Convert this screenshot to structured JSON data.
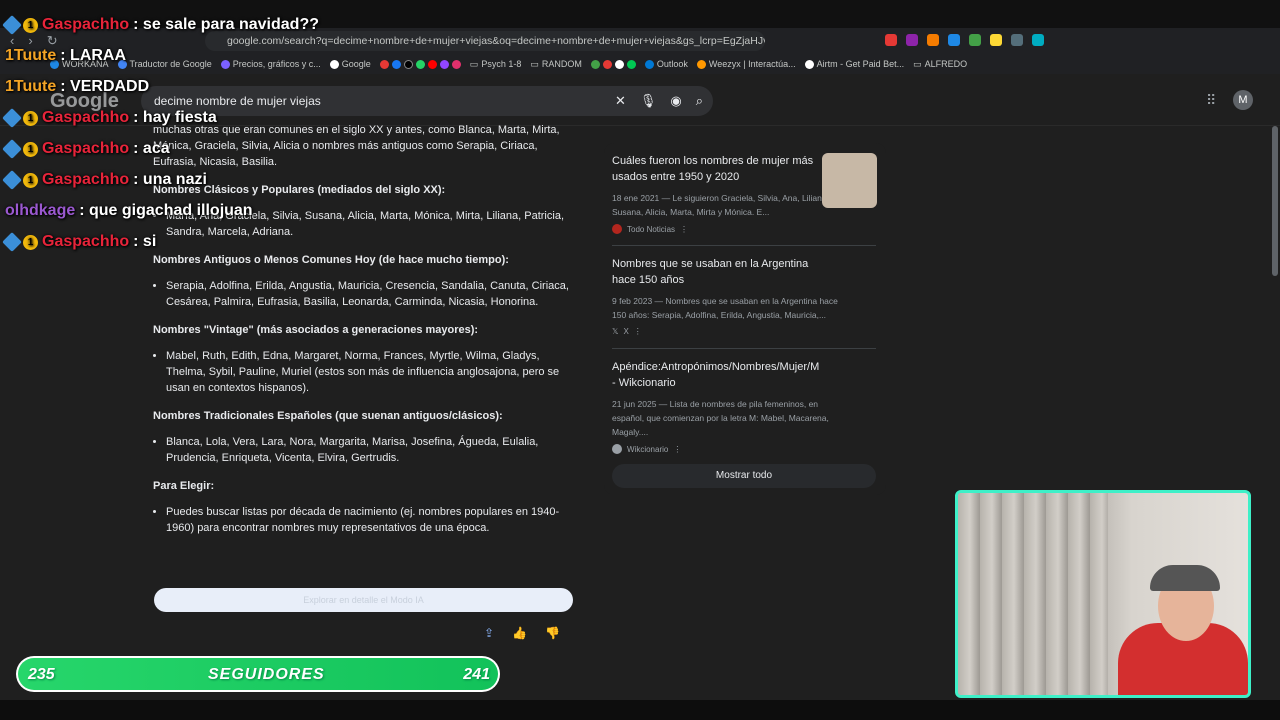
{
  "browser": {
    "url": "google.com/search?q=decime+nombre+de+mujer+viejas&oq=decime+nombre+de+mujer+viejas&gs_lcrp=EgZjaHJvbW...",
    "bookmarks": [
      "WORKANA",
      "Traductor de Google",
      "Precios, gráficos y c...",
      "Google",
      "Psych 1-8",
      "RANDOM",
      "Outlook",
      "Weezyx | Interactúa...",
      "Airtm - Get Paid Bet...",
      "ALFREDO"
    ]
  },
  "search": {
    "logo": "Google",
    "query": "decime nombre de mujer viejas",
    "avatar_letter": "M"
  },
  "ai_overview": {
    "intro": "muchas otras que eran comunes en el siglo XX y antes, como Blanca, Marta, Mirta, Mónica, Graciela, Silvia, Alicia o nombres más antiguos como Serapia, Ciriaca, Eufrasia, Nicasia, Basilia.",
    "sections": [
      {
        "heading": "Nombres Clásicos y Populares (mediados del siglo XX):",
        "items": [
          "María, Ana, Graciela, Silvia, Susana, Alicia, Marta, Mónica, Mirta, Liliana, Patricia, Sandra, Marcela, Adriana."
        ]
      },
      {
        "heading": "Nombres Antiguos o Menos Comunes Hoy (de hace mucho tiempo):",
        "items": [
          "Serapia, Adolfina, Erilda, Angustia, Mauricia, Cresencia, Sandalia, Canuta, Ciriaca, Cesárea, Palmira, Eufrasia, Basilia, Leonarda, Carminda, Nicasia, Honorina."
        ]
      },
      {
        "heading": "Nombres \"Vintage\" (más asociados a generaciones mayores):",
        "items": [
          "Mabel, Ruth, Edith, Edna, Margaret, Norma, Frances, Myrtle, Wilma, Gladys, Thelma, Sybil, Pauline, Muriel (estos son más de influencia anglosajona, pero se usan en contextos hispanos)."
        ]
      },
      {
        "heading": "Nombres Tradicionales Españoles (que suenan antiguos/clásicos):",
        "items": [
          "Blanca, Lola, Vera, Lara, Nora, Margarita, Marisa, Josefina, Águeda, Eulalia, Prudencia, Enriqueta, Vicenta, Elvira, Gertrudis."
        ]
      },
      {
        "heading": "Para Elegir:",
        "items": [
          "Puedes buscar listas por década de nacimiento (ej. nombres populares en 1940-1960) para encontrar nombres muy representativos de una época."
        ]
      }
    ],
    "explore_label": "Explorar en detalle el Modo IA"
  },
  "sources": [
    {
      "title": "Cuáles fueron los nombres de mujer más usados entre 1950 y 2020",
      "desc": "18 ene 2021 — Le siguieron Graciela, Silvia, Ana, Liliana, Susana, Alicia, Marta, Mirta y Mónica. E...",
      "site": "Todo Noticias"
    },
    {
      "title": "Nombres que se usaban en la Argentina hace 150 años",
      "desc": "9 feb 2023 — Nombres que se usaban en la Argentina hace 150 años: Serapia, Adolfina, Erilda, Angustia, Mauricia,...",
      "site": "X"
    },
    {
      "title": "Apéndice:Antropónimos/Nombres/Mujer/M - Wikcionario",
      "desc": "21 jun 2025 — Lista de nombres de pila femeninos, en español, que comienzan por la letra M: Mabel, Macarena, Magaly....",
      "site": "Wikcionario"
    }
  ],
  "show_all_label": "Mostrar todo",
  "chat": [
    {
      "user": "Gaspachho",
      "msg": ": se sale para navidad??"
    },
    {
      "user": "1Tuute",
      "msg": ": LARAA"
    },
    {
      "user": "1Tuute",
      "msg": ": VERDADD"
    },
    {
      "user": "Gaspachho",
      "msg": ": hay fiesta"
    },
    {
      "user": "Gaspachho",
      "msg": ": aca"
    },
    {
      "user": "Gaspachho",
      "msg": ": una nazi"
    },
    {
      "user": "olhdkage",
      "msg": ": que gigachad illojuan"
    },
    {
      "user": "Gaspachho",
      "msg": ": si"
    }
  ],
  "followers": {
    "current": "235",
    "label": "SEGUIDORES",
    "goal": "241"
  }
}
